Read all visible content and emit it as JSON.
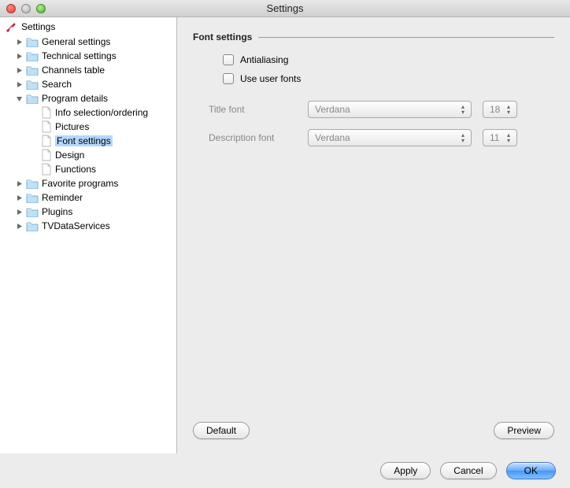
{
  "window": {
    "title": "Settings"
  },
  "sidebar": {
    "root_label": "Settings",
    "items": [
      {
        "label": "General settings",
        "expanded": false,
        "children": []
      },
      {
        "label": "Technical settings",
        "expanded": false,
        "children": []
      },
      {
        "label": "Channels table",
        "expanded": false,
        "children": []
      },
      {
        "label": "Search",
        "expanded": false,
        "children": []
      },
      {
        "label": "Program details",
        "expanded": true,
        "children": [
          {
            "label": "Info selection/ordering",
            "selected": false
          },
          {
            "label": "Pictures",
            "selected": false
          },
          {
            "label": "Font settings",
            "selected": true
          },
          {
            "label": "Design",
            "selected": false
          },
          {
            "label": "Functions",
            "selected": false
          }
        ]
      },
      {
        "label": "Favorite programs",
        "expanded": false,
        "children": []
      },
      {
        "label": "Reminder",
        "expanded": false,
        "children": []
      },
      {
        "label": "Plugins",
        "expanded": false,
        "children": []
      },
      {
        "label": "TVDataServices",
        "expanded": false,
        "children": []
      }
    ]
  },
  "main": {
    "header": "Font settings",
    "antialiasing_label": "Antialiasing",
    "use_user_fonts_label": "Use user fonts",
    "title_font_label": "Title font",
    "title_font_value": "Verdana",
    "title_font_size": "18",
    "description_font_label": "Description font",
    "description_font_value": "Verdana",
    "description_font_size": "11",
    "default_button": "Default",
    "preview_button": "Preview"
  },
  "dialog": {
    "apply": "Apply",
    "cancel": "Cancel",
    "ok": "OK"
  }
}
